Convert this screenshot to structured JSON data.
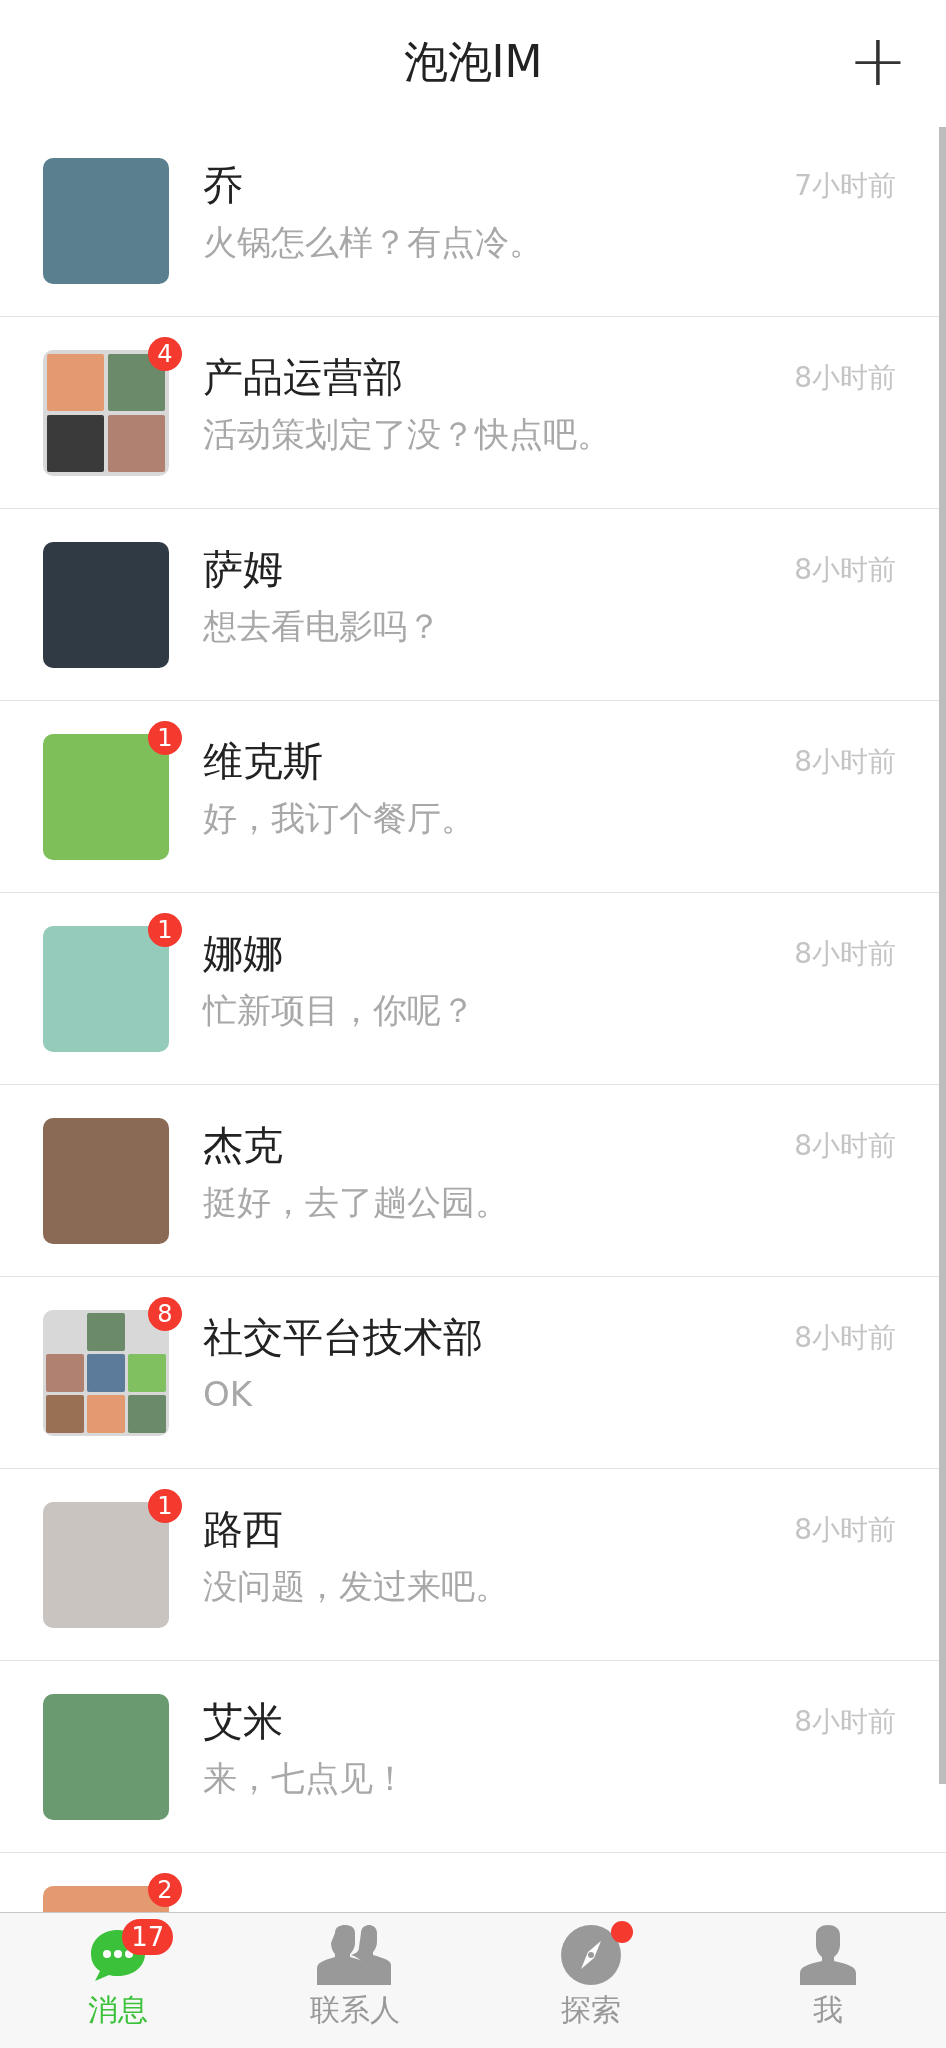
{
  "header": {
    "title": "泡泡IM",
    "add_button": "+"
  },
  "chats": [
    {
      "name": "乔",
      "message": "火锅怎么样？有点冷。",
      "time": "7小时前",
      "avatar": {
        "kind": "photo",
        "color": "#5a8090"
      }
    },
    {
      "name": "产品运营部",
      "message": "活动策划定了没？快点吧。",
      "time": "8小时前",
      "badge": "4",
      "avatar": {
        "kind": "group4",
        "color": "#d8d8d8"
      }
    },
    {
      "name": "萨姆",
      "message": "想去看电影吗？",
      "time": "8小时前",
      "avatar": {
        "kind": "photo",
        "color": "#2f3a45"
      }
    },
    {
      "name": "维克斯",
      "message": "好，我订个餐厅。",
      "time": "8小时前",
      "badge": "1",
      "avatar": {
        "kind": "photo",
        "color": "#7fbf5a"
      }
    },
    {
      "name": "娜娜",
      "message": "忙新项目，你呢？",
      "time": "8小时前",
      "badge": "1",
      "avatar": {
        "kind": "photo",
        "color": "#94cbbb"
      }
    },
    {
      "name": "杰克",
      "message": "挺好，去了趟公园。",
      "time": "8小时前",
      "avatar": {
        "kind": "photo",
        "color": "#8a6a55"
      }
    },
    {
      "name": "社交平台技术部",
      "message": "OK",
      "time": "8小时前",
      "badge": "8",
      "avatar": {
        "kind": "group7",
        "color": "#d8d8d8"
      }
    },
    {
      "name": "路西",
      "message": "没问题，发过来吧。",
      "time": "8小时前",
      "badge": "1",
      "avatar": {
        "kind": "photo",
        "color": "#c9c4c0"
      }
    },
    {
      "name": "艾米",
      "message": "来，七点见！",
      "time": "8小时前",
      "avatar": {
        "kind": "photo",
        "color": "#6a9a70"
      }
    },
    {
      "badge": "2",
      "avatar": {
        "kind": "photo",
        "color": "#e39a70"
      }
    }
  ],
  "tabs": [
    {
      "label": "消息",
      "selected": true,
      "badge": "17",
      "dot": false
    },
    {
      "label": "联系人",
      "selected": false,
      "dot": false
    },
    {
      "label": "探索",
      "selected": false,
      "dot": true
    },
    {
      "label": "我",
      "selected": false,
      "dot": false
    }
  ]
}
